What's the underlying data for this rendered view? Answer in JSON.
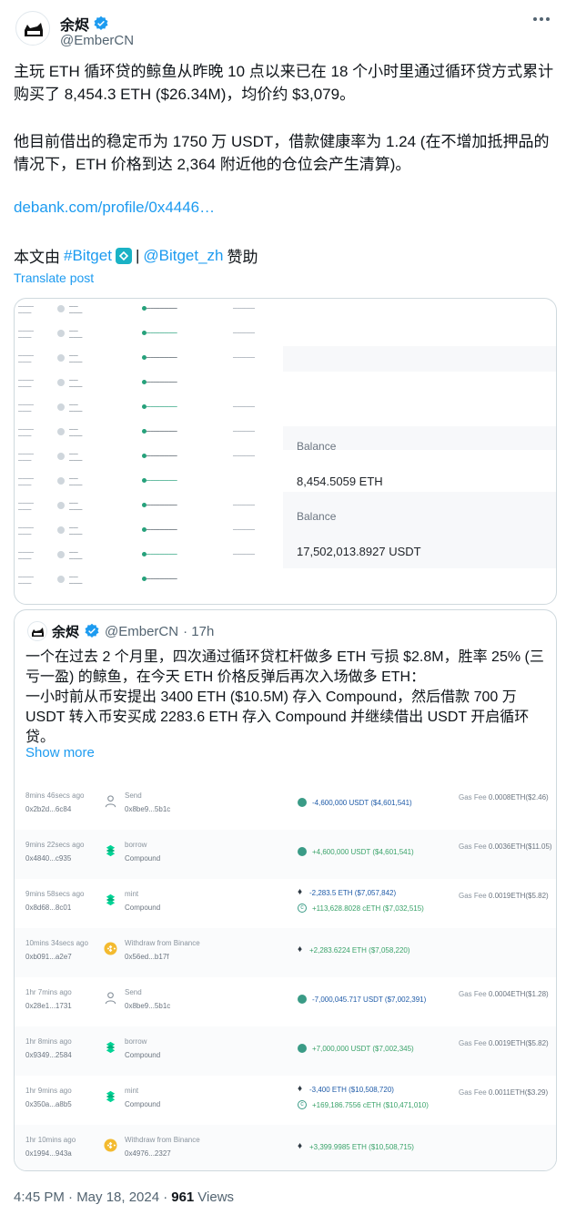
{
  "author": {
    "name": "余烬",
    "handle": "@EmberCN"
  },
  "tweet": {
    "paragraph1": "主玩 ETH 循环贷的鲸鱼从昨晚 10 点以来已在 18 个小时里通过循环贷方式累计购买了 8,454.3 ETH ($26.34M)，均价约 $3,079。",
    "paragraph2": "他目前借出的稳定币为 1750 万 USDT，借款健康率为 1.24 (在不增加抵押品的情况下，ETH 价格到达 2,364 附近他的仓位会产生清算)。",
    "link": "debank.com/profile/0x4446…",
    "sponsor_prefix": "本文由",
    "sponsor_tag": "#Bitget",
    "sponsor_sep": "|",
    "sponsor_handle": "@Bitget_zh",
    "sponsor_suffix": "赞助",
    "translate": "Translate post"
  },
  "media1": {
    "balance_label_1": "Balance",
    "balance_value_1": "8,454.5059 ETH",
    "balance_label_2": "Balance",
    "balance_value_2": "17,502,013.8927 USDT"
  },
  "quote": {
    "name": "余烬",
    "handle": "@EmberCN",
    "time": "· 17h",
    "text": "一个在过去 2 个月里，四次通过循环贷杠杆做多 ETH 亏损 $2.8M，胜率 25% (三亏一盈) 的鲸鱼，在今天 ETH 价格反弹后再次入场做多 ETH：\n一小时前从币安提出 3400 ETH ($10.5M) 存入 Compound，然后借款 700 万 USDT 转入币安买成 2283.6 ETH 存入 Compound 并继续借出 USDT 开启循环贷。",
    "show_more": "Show more",
    "transactions": [
      {
        "time": "8mins 46secs ago",
        "hash": "0x2b2d...6c84",
        "icon": "person-icon",
        "action": "Send",
        "target": "0x8be9...5b1c",
        "amounts": [
          {
            "sym": "usdt",
            "text": "-4,600,000 USDT ($4,601,541)",
            "sign": "neg"
          }
        ],
        "fee_label": "Gas Fee",
        "fee": "0.0008ETH($2.46)"
      },
      {
        "time": "9mins 22secs ago",
        "hash": "0x4840...c935",
        "icon": "compound-icon",
        "action": "borrow",
        "target": "Compound",
        "amounts": [
          {
            "sym": "usdt",
            "text": "+4,600,000 USDT ($4,601,541)",
            "sign": "pos"
          }
        ],
        "fee_label": "Gas Fee",
        "fee": "0.0036ETH($11.05)"
      },
      {
        "time": "9mins 58secs ago",
        "hash": "0x8d68...8c01",
        "icon": "compound-icon",
        "action": "mint",
        "target": "Compound",
        "amounts": [
          {
            "sym": "eth",
            "text": "-2,283.5 ETH ($7,057,842)",
            "sign": "neg"
          },
          {
            "sym": "ceth",
            "text": "+113,628.8028 cETH ($7,032,515)",
            "sign": "pos"
          }
        ],
        "fee_label": "Gas Fee",
        "fee": "0.0019ETH($5.82)"
      },
      {
        "time": "10mins 34secs ago",
        "hash": "0xb091...a2e7",
        "icon": "binance-icon",
        "action": "Withdraw from Binance",
        "target": "0x56ed...b17f",
        "amounts": [
          {
            "sym": "eth",
            "text": "+2,283.6224 ETH ($7,058,220)",
            "sign": "pos"
          }
        ],
        "fee_label": "",
        "fee": ""
      },
      {
        "time": "1hr 7mins ago",
        "hash": "0x28e1...1731",
        "icon": "person-icon",
        "action": "Send",
        "target": "0x8be9...5b1c",
        "amounts": [
          {
            "sym": "usdt",
            "text": "-7,000,045.717 USDT ($7,002,391)",
            "sign": "neg"
          }
        ],
        "fee_label": "Gas Fee",
        "fee": "0.0004ETH($1.28)"
      },
      {
        "time": "1hr 8mins ago",
        "hash": "0x9349...2584",
        "icon": "compound-icon",
        "action": "borrow",
        "target": "Compound",
        "amounts": [
          {
            "sym": "usdt",
            "text": "+7,000,000 USDT ($7,002,345)",
            "sign": "pos"
          }
        ],
        "fee_label": "Gas Fee",
        "fee": "0.0019ETH($5.82)"
      },
      {
        "time": "1hr 9mins ago",
        "hash": "0x350a...a8b5",
        "icon": "compound-icon",
        "action": "mint",
        "target": "Compound",
        "amounts": [
          {
            "sym": "eth",
            "text": "-3,400 ETH ($10,508,720)",
            "sign": "neg"
          },
          {
            "sym": "ceth",
            "text": "+169,186.7556 cETH ($10,471,010)",
            "sign": "pos"
          }
        ],
        "fee_label": "Gas Fee",
        "fee": "0.0011ETH($3.29)"
      },
      {
        "time": "1hr 10mins ago",
        "hash": "0x1994...943a",
        "icon": "binance-icon",
        "action": "Withdraw from Binance",
        "target": "0x4976...2327",
        "amounts": [
          {
            "sym": "eth",
            "text": "+3,399.9985 ETH ($10,508,715)",
            "sign": "pos"
          }
        ],
        "fee_label": "",
        "fee": ""
      }
    ]
  },
  "footer": {
    "time": "4:45 PM · May 18, 2024 ·",
    "views_count": "961",
    "views_label": "Views"
  },
  "colors": {
    "link": "#1d9bf0",
    "text": "#0f1419",
    "muted": "#536471",
    "border": "#cfd9de"
  }
}
